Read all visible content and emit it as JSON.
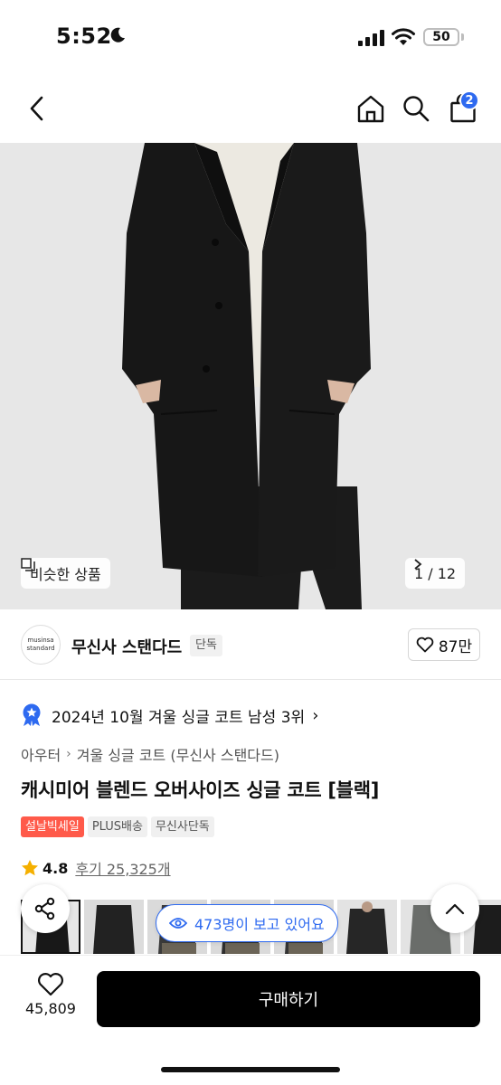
{
  "status_bar": {
    "time": "5:52",
    "battery": "50"
  },
  "nav": {
    "cart_count": "2"
  },
  "gallery": {
    "similar_label": "비슷한 상품",
    "page_indicator": "1 / 12"
  },
  "brand": {
    "logo_line1": "musinsa",
    "logo_line2": "standard",
    "name": "무신사 스탠다드",
    "badge": "단독",
    "likes": "87만"
  },
  "ranking": {
    "text": "2024년 10월 겨울 싱글 코트 남성 3위"
  },
  "breadcrumb": {
    "category": "아우터",
    "subcategory": "겨울 싱글 코트 (무신사 스탠다드)"
  },
  "product": {
    "title": "캐시미어 블렌드 오버사이즈 싱글 코트 [블랙]",
    "tags": [
      "설날빅세일",
      "PLUS배송",
      "무신사단독"
    ],
    "rating": "4.8",
    "reviews": "후기 25,325개"
  },
  "viewers": {
    "text": "473명이 보고 있어요"
  },
  "bottom_bar": {
    "wish_count": "45,809",
    "buy_label": "구매하기"
  },
  "colors": {
    "accent": "#2e6af0",
    "sale": "#ff5a4a",
    "buy_button": "#000000"
  }
}
